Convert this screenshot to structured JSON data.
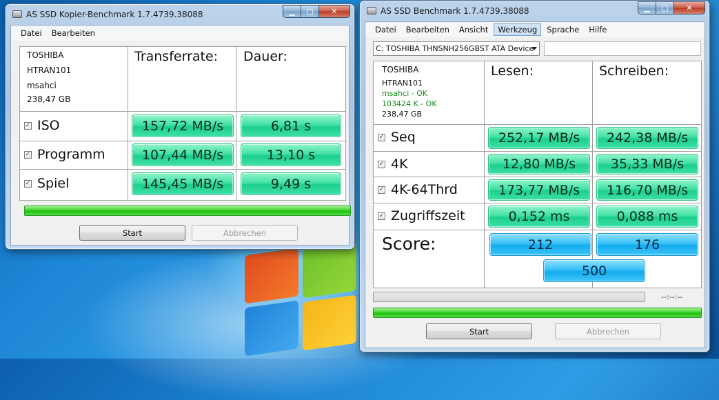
{
  "copy_window": {
    "title": "AS SSD Kopier-Benchmark 1.7.4739.38088",
    "menu": [
      "Datei",
      "Bearbeiten"
    ],
    "drive_info": [
      "TOSHIBA",
      "HTRAN101",
      "msahci",
      "238,47 GB"
    ],
    "headers": {
      "transfer": "Transferrate:",
      "duration": "Dauer:"
    },
    "rows": [
      {
        "label": "ISO",
        "checked": true,
        "transfer": "157,72 MB/s",
        "duration": "6,81 s"
      },
      {
        "label": "Programm",
        "checked": true,
        "transfer": "107,44 MB/s",
        "duration": "13,10 s"
      },
      {
        "label": "Spiel",
        "checked": true,
        "transfer": "145,45 MB/s",
        "duration": "9,49 s"
      }
    ],
    "progress_fraction": 1.0,
    "buttons": {
      "start": "Start",
      "cancel": "Abbrechen"
    }
  },
  "bench_window": {
    "title": "AS SSD Benchmark 1.7.4739.38088",
    "menu": [
      "Datei",
      "Bearbeiten",
      "Ansicht",
      "Werkzeug",
      "Sprache",
      "Hilfe"
    ],
    "active_menu": "Werkzeug",
    "drive_select": "C: TOSHIBA THNSNH256GBST ATA Device",
    "drive_info": {
      "vendor": "TOSHIBA",
      "firmware": "HTRAN101",
      "driver": "msahci - OK",
      "alignment": "103424 K - OK",
      "size": "238,47 GB"
    },
    "headers": {
      "read": "Lesen:",
      "write": "Schreiben:"
    },
    "rows": [
      {
        "label": "Seq",
        "checked": true,
        "read": "252,17 MB/s",
        "write": "242,38 MB/s"
      },
      {
        "label": "4K",
        "checked": true,
        "read": "12,80 MB/s",
        "write": "35,33 MB/s"
      },
      {
        "label": "4K-64Thrd",
        "checked": true,
        "read": "173,77 MB/s",
        "write": "116,70 MB/s"
      },
      {
        "label": "Zugriffszeit",
        "checked": true,
        "read": "0,152 ms",
        "write": "0,088 ms"
      }
    ],
    "score": {
      "label": "Score:",
      "read": "212",
      "write": "176",
      "total": "500"
    },
    "time_display": "--:--:--",
    "progress_top_fraction": 0.0,
    "progress_bottom_fraction": 1.0,
    "buttons": {
      "start": "Start",
      "cancel": "Abbrechen"
    }
  },
  "colors": {
    "result_green": "#1ccf8c",
    "score_blue": "#12aaf0",
    "progress_green": "#1fbf12",
    "ok_text": "#1c8a1c"
  },
  "icons": {
    "title": "drive-icon",
    "minimize": "minimize-icon",
    "maximize": "maximize-icon",
    "close": "close-icon",
    "checkbox": "checkbox-checked-icon",
    "dropdown": "chevron-down-icon"
  }
}
